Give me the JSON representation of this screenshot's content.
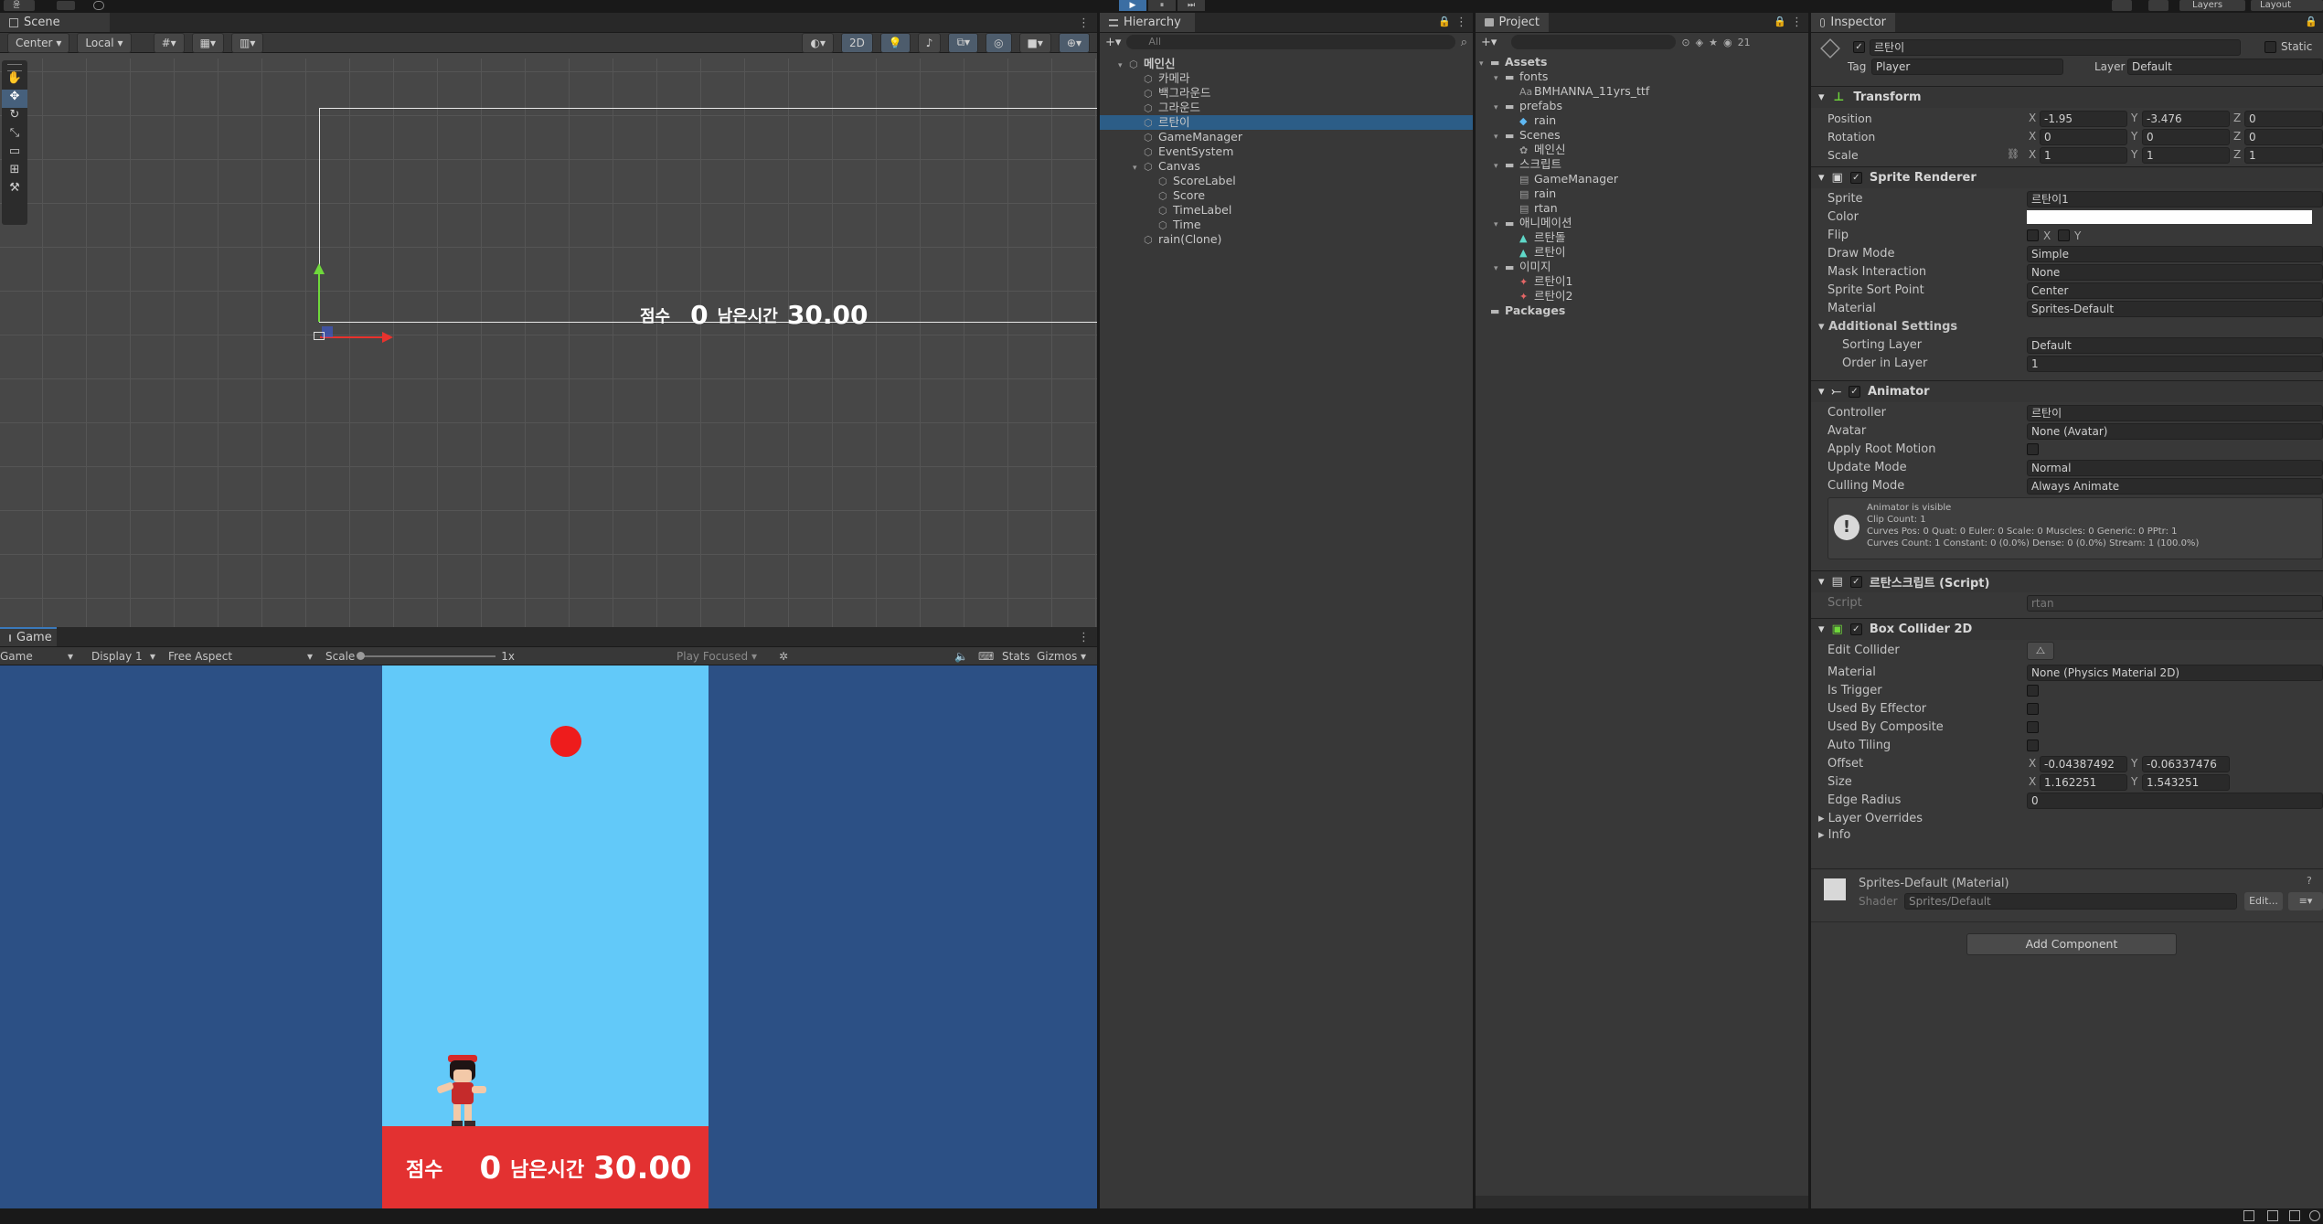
{
  "toolbar": {
    "account": "윤",
    "play": "▶",
    "pause": "⏸",
    "step": "⏭",
    "layers": "Layers",
    "layout": "Layout"
  },
  "scene": {
    "tab": "Scene",
    "pivot": "Center",
    "space": "Local",
    "mode2d": "2D",
    "score_label": "점수",
    "score": "0",
    "time_label": "남은시간",
    "time": "30.00"
  },
  "game": {
    "tab": "Game",
    "view": "Game",
    "display": "Display 1",
    "aspect": "Free Aspect",
    "scale_label": "Scale",
    "scale_value": "1x",
    "play_focused": "Play Focused",
    "stats": "Stats",
    "gizmos": "Gizmos",
    "score_label": "점수",
    "score": "0",
    "time_label": "남은시간",
    "time": "30.00"
  },
  "hierarchy": {
    "tab": "Hierarchy",
    "search": "All",
    "items": [
      {
        "label": "메인신",
        "depth": 0,
        "bold": true
      },
      {
        "label": "카메라",
        "depth": 1
      },
      {
        "label": "백그라운드",
        "depth": 1
      },
      {
        "label": "그라운드",
        "depth": 1
      },
      {
        "label": "르탄이",
        "depth": 1,
        "selected": true
      },
      {
        "label": "GameManager",
        "depth": 1
      },
      {
        "label": "EventSystem",
        "depth": 1
      },
      {
        "label": "Canvas",
        "depth": 1
      },
      {
        "label": "ScoreLabel",
        "depth": 2
      },
      {
        "label": "Score",
        "depth": 2
      },
      {
        "label": "TimeLabel",
        "depth": 2
      },
      {
        "label": "Time",
        "depth": 2
      },
      {
        "label": "rain(Clone)",
        "depth": 1
      }
    ]
  },
  "project": {
    "tab": "Project",
    "count": "21",
    "items": [
      {
        "label": "Assets",
        "depth": 0,
        "bold": true,
        "type": "folder"
      },
      {
        "label": "fonts",
        "depth": 1,
        "type": "folder"
      },
      {
        "label": "BMHANNA_11yrs_ttf",
        "depth": 2,
        "type": "font"
      },
      {
        "label": "prefabs",
        "depth": 1,
        "type": "folder"
      },
      {
        "label": "rain",
        "depth": 2,
        "type": "prefab"
      },
      {
        "label": "Scenes",
        "depth": 1,
        "type": "folder"
      },
      {
        "label": "메인신",
        "depth": 2,
        "type": "scene"
      },
      {
        "label": "스크립트",
        "depth": 1,
        "type": "folder"
      },
      {
        "label": "GameManager",
        "depth": 2,
        "type": "script"
      },
      {
        "label": "rain",
        "depth": 2,
        "type": "script"
      },
      {
        "label": "rtan",
        "depth": 2,
        "type": "script"
      },
      {
        "label": "애니메이션",
        "depth": 1,
        "type": "folder"
      },
      {
        "label": "르탄돌",
        "depth": 2,
        "type": "anim"
      },
      {
        "label": "르탄이",
        "depth": 2,
        "type": "anim"
      },
      {
        "label": "이미지",
        "depth": 1,
        "type": "folder"
      },
      {
        "label": "르탄이1",
        "depth": 2,
        "type": "sprite"
      },
      {
        "label": "르탄이2",
        "depth": 2,
        "type": "sprite"
      },
      {
        "label": "Packages",
        "depth": 0,
        "bold": true,
        "type": "folder"
      }
    ]
  },
  "inspector": {
    "tab": "Inspector",
    "name": "르탄이",
    "static": "Static",
    "tag_label": "Tag",
    "tag": "Player",
    "layer_label": "Layer",
    "layer": "Default",
    "transform": {
      "title": "Transform",
      "position_label": "Position",
      "rotation_label": "Rotation",
      "scale_label": "Scale",
      "px": "-1.95",
      "py": "-3.476",
      "pz": "0",
      "rx": "0",
      "ry": "0",
      "rz": "0",
      "sx": "1",
      "sy": "1",
      "sz": "1"
    },
    "sprite": {
      "title": "Sprite Renderer",
      "sprite_label": "Sprite",
      "sprite": "르탄이1",
      "color_label": "Color",
      "flip_label": "Flip",
      "draw_label": "Draw Mode",
      "draw": "Simple",
      "mask_label": "Mask Interaction",
      "mask": "None",
      "sort_label": "Sprite Sort Point",
      "sort": "Center",
      "mat_label": "Material",
      "mat": "Sprites-Default",
      "additional": "Additional Settings",
      "sl_label": "Sorting Layer",
      "sl": "Default",
      "oil_label": "Order in Layer",
      "oil": "1"
    },
    "animator": {
      "title": "Animator",
      "ctrl_label": "Controller",
      "ctrl": "르탄이",
      "avatar_label": "Avatar",
      "avatar": "None (Avatar)",
      "arm_label": "Apply Root Motion",
      "upd_label": "Update Mode",
      "upd": "Normal",
      "cull_label": "Culling Mode",
      "cull": "Always Animate",
      "info1": "Animator is visible",
      "info2": "Clip Count: 1",
      "info3": "Curves Pos: 0 Quat: 0 Euler: 0 Scale: 0 Muscles: 0 Generic: 0 PPtr: 1",
      "info4": "Curves Count: 1 Constant: 0 (0.0%) Dense: 0 (0.0%) Stream: 1 (100.0%)"
    },
    "script": {
      "title": "르탄스크립트 (Script)",
      "label": "Script",
      "value": "rtan"
    },
    "collider": {
      "title": "Box Collider 2D",
      "edit_label": "Edit Collider",
      "mat_label": "Material",
      "mat": "None (Physics Material 2D)",
      "trig_label": "Is Trigger",
      "eff_label": "Used By Effector",
      "comp_label": "Used By Composite",
      "tile_label": "Auto Tiling",
      "off_label": "Offset",
      "ox": "-0.04387492",
      "oy": "-0.06337476",
      "size_label": "Size",
      "w": "1.162251",
      "h": "1.543251",
      "edge_label": "Edge Radius",
      "edge": "0",
      "layer_over": "Layer Overrides",
      "info": "Info"
    },
    "material": {
      "name": "Sprites-Default (Material)",
      "shader_label": "Shader",
      "shader": "Sprites/Default",
      "edit": "Edit..."
    },
    "add": "Add Component"
  }
}
